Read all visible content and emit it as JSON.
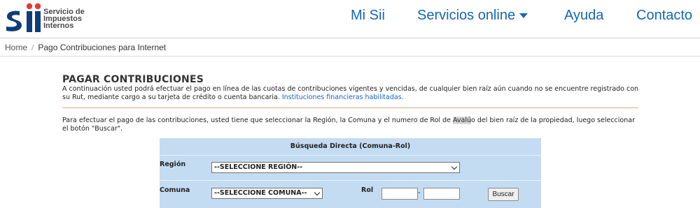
{
  "header": {
    "logo": {
      "mark": "Sii",
      "lines": [
        "Servicio de",
        "Impuestos",
        "Internos"
      ]
    },
    "nav": [
      {
        "label": "Mi Sii"
      },
      {
        "label": "Servicios online",
        "has_dropdown": true
      },
      {
        "label": "Ayuda"
      },
      {
        "label": "Contacto"
      }
    ]
  },
  "breadcrumb": {
    "home": "Home",
    "current": "Pago Contribuciones para Internet"
  },
  "main": {
    "title": "PAGAR CONTRIBUCIONES",
    "intro": "A continuación usted podrá efectuar el pago en línea de las cuotas de contribuciones vigentes y vencidas, de cualquier bien raíz aún cuando no se encuentre registrado con su Rut, mediante cargo a su tarjeta de crédito o cuenta bancaria.",
    "intro_link": "Instituciones financieras habilitadas.",
    "instructions_pre": "Para efectuar el pago de las contribuciones, usted tiene que seleccionar la Región, la Comuna y el numero de Rol de ",
    "instructions_hl": "Avalú",
    "instructions_post": "o del bien raíz de la propiedad, luego seleccionar el botón \"Buscar\"."
  },
  "search": {
    "heading": "Búsqueda Directa (Comuna-Rol)",
    "region_label": "Región",
    "region_value": "--SELECCIONE REGIÓN--",
    "comuna_label": "Comuna",
    "comuna_value": "--SELECCIONE COMUNA--",
    "rol_label": "Rol",
    "rol_separator": "-",
    "rol_part1": "",
    "rol_part2": "",
    "button": "Buscar"
  },
  "colors": {
    "brand_blue": "#1466b8",
    "logo_red": "#e63a2e",
    "panel_bg": "#c4dcf2",
    "accent_rule": "#e7a27a"
  }
}
